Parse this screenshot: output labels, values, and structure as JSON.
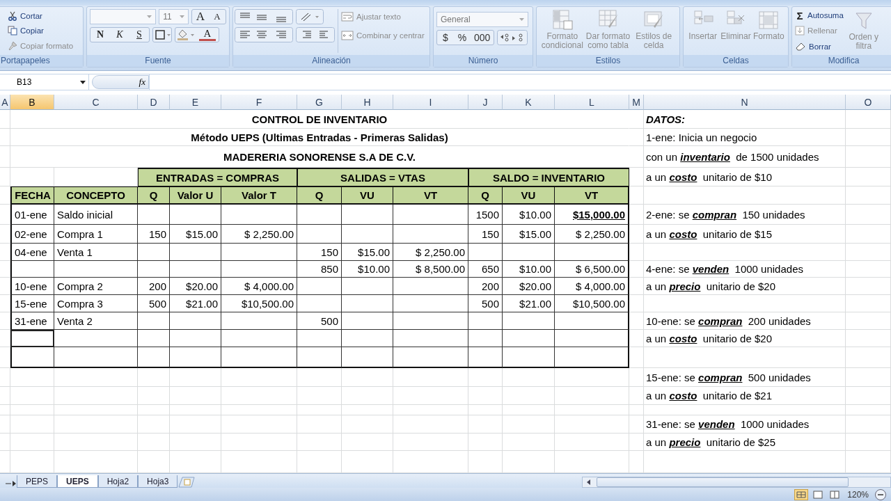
{
  "ribbon": {
    "clipboard": {
      "label": "Portapapeles",
      "items": [
        {
          "label": "Cortar",
          "kind": "cut",
          "disabled": false
        },
        {
          "label": "Copiar",
          "kind": "copy",
          "disabled": false
        },
        {
          "label": "Copiar formato",
          "kind": "brush",
          "disabled": true
        }
      ]
    },
    "font": {
      "label": "Fuente",
      "size": "11",
      "grow": "A",
      "shrink": "A",
      "styles": [
        "N",
        "K",
        "S"
      ],
      "color_button": "A"
    },
    "alignment": {
      "label": "Alineación",
      "items": [
        {
          "label": "Ajustar texto",
          "kind": "wrap",
          "disabled": true
        },
        {
          "label": "Combinar y centrar",
          "kind": "merge",
          "disabled": true
        }
      ]
    },
    "number": {
      "label": "Número",
      "format": "General",
      "buttons": [
        "$",
        "%",
        "000"
      ]
    },
    "styles": {
      "label": "Estilos",
      "items": [
        {
          "label": "Formato condicional",
          "kind": "conditional",
          "disabled": true
        },
        {
          "label": "Dar formato como tabla",
          "kind": "table",
          "disabled": true
        },
        {
          "label": "Estilos de celda",
          "kind": "cellstyle",
          "disabled": true
        }
      ]
    },
    "cells": {
      "label": "Celdas",
      "items": [
        {
          "label": "Insertar",
          "kind": "insert",
          "disabled": true
        },
        {
          "label": "Eliminar",
          "kind": "delete",
          "disabled": true
        },
        {
          "label": "Formato",
          "kind": "format",
          "disabled": true
        }
      ]
    },
    "editing": {
      "label": "Modifica",
      "items": [
        {
          "label": "Autosuma",
          "kind": "sum",
          "disabled": false
        },
        {
          "label": "Rellenar",
          "kind": "fill",
          "disabled": true
        },
        {
          "label": "Borrar",
          "kind": "erase",
          "disabled": false
        }
      ],
      "sum_symbol": "Σ",
      "sort_label": "Orden y filtra"
    }
  },
  "formula_bar": {
    "name_box": "B13",
    "function_label": "fx"
  },
  "columns": [
    {
      "label": "A",
      "selected": false
    },
    {
      "label": "B",
      "selected": true
    },
    {
      "label": "C",
      "selected": false
    },
    {
      "label": "D",
      "selected": false
    },
    {
      "label": "E",
      "selected": false
    },
    {
      "label": "F",
      "selected": false
    },
    {
      "label": "G",
      "selected": false
    },
    {
      "label": "H",
      "selected": false
    },
    {
      "label": "I",
      "selected": false
    },
    {
      "label": "J",
      "selected": false
    },
    {
      "label": "K",
      "selected": false
    },
    {
      "label": "L",
      "selected": false
    },
    {
      "label": "M",
      "selected": false
    },
    {
      "label": "N",
      "selected": false
    },
    {
      "label": "O",
      "selected": false
    }
  ],
  "rows": [
    {
      "kind": "title",
      "text": "CONTROL DE INVENTARIO",
      "note": {
        "text": "DATOS:",
        "heading": true
      }
    },
    {
      "kind": "title",
      "text": "Método UEPS (Ultimas Entradas - Primeras Salidas)",
      "note": {
        "text": "1-ene: Inicia un negocio",
        "heading": false
      }
    },
    {
      "kind": "title",
      "text": "MADERERIA SONORENSE S.A DE C.V.",
      "note": {
        "text": "con un **inventario**  de 1500 unidades",
        "heading": false
      }
    },
    {
      "kind": "group",
      "groups": [
        {
          "label": "ENTRADAS = COMPRAS"
        },
        {
          "label": "SALIDAS = VTAS"
        },
        {
          "label": "SALDO = INVENTARIO"
        }
      ],
      "note": {
        "text": "a un **costo**  unitario de $10",
        "heading": false
      }
    },
    {
      "kind": "header",
      "cells": [
        "FECHA",
        "CONCEPTO",
        "Q",
        "Valor U",
        "Valor T",
        "Q",
        "VU",
        "VT",
        "Q",
        "VU",
        "VT"
      ]
    },
    {
      "kind": "data",
      "selected": false,
      "saldo_vt_bold": true,
      "fecha": "01-ene",
      "concepto": "Saldo inicial",
      "saldo_q": "1500",
      "saldo_vu": "$10.00",
      "saldo_vt": "$15,000.00",
      "note": {
        "text": "2-ene: se **compran**  150 unidades",
        "heading": false
      }
    },
    {
      "kind": "data",
      "selected": false,
      "saldo_vt_bold": false,
      "fecha": "02-ene",
      "concepto": "Compra 1",
      "entrada_q": "150",
      "entrada_vu": "$15.00",
      "entrada_vt": "$ 2,250.00",
      "saldo_q": "150",
      "saldo_vu": "$15.00",
      "saldo_vt": "$ 2,250.00",
      "note": {
        "text": "a un **costo**  unitario de $15",
        "heading": false
      }
    },
    {
      "kind": "data",
      "selected": false,
      "fecha": "04-ene",
      "concepto": "Venta 1",
      "salida_q": "150",
      "salida_vu": "$15.00",
      "salida_vt": "$ 2,250.00"
    },
    {
      "kind": "data",
      "selected": false,
      "saldo_vt_bold": false,
      "salida_q": "850",
      "salida_vu": "$10.00",
      "salida_vt": "$ 8,500.00",
      "saldo_q": "650",
      "saldo_vu": "$10.00",
      "saldo_vt": "$ 6,500.00",
      "note": {
        "text": "4-ene: se **venden**  1000 unidades",
        "heading": false
      }
    },
    {
      "kind": "data",
      "selected": false,
      "saldo_vt_bold": false,
      "fecha": "10-ene",
      "concepto": "Compra 2",
      "entrada_q": "200",
      "entrada_vu": "$20.00",
      "entrada_vt": "$ 4,000.00",
      "saldo_q": "200",
      "saldo_vu": "$20.00",
      "saldo_vt": "$ 4,000.00",
      "note": {
        "text": "a un **precio**  unitario de $20",
        "heading": false
      }
    },
    {
      "kind": "data",
      "selected": false,
      "saldo_vt_bold": false,
      "fecha": "15-ene",
      "concepto": "Compra 3",
      "entrada_q": "500",
      "entrada_vu": "$21.00",
      "entrada_vt": "$10,500.00",
      "saldo_q": "500",
      "saldo_vu": "$21.00",
      "saldo_vt": "$10,500.00"
    },
    {
      "kind": "data",
      "selected": false,
      "fecha": "31-ene",
      "concepto": "Venta 2",
      "salida_q": "500",
      "note": {
        "text": "10-ene: se **compran**  200 unidades",
        "heading": false
      }
    },
    {
      "kind": "data",
      "selected": true,
      "note": {
        "text": "a un **costo**  unitario de $20",
        "heading": false
      }
    },
    {
      "kind": "data",
      "selected": false
    },
    {
      "kind": "blank",
      "note": {
        "text": "15-ene: se **compran**  500 unidades",
        "heading": false
      }
    },
    {
      "kind": "blank",
      "note": {
        "text": "a un **costo**  unitario de $21",
        "heading": false
      }
    },
    {
      "kind": "blank"
    },
    {
      "kind": "blank",
      "note": {
        "text": "31-ene: se **venden**  1000 unidades",
        "heading": false
      }
    },
    {
      "kind": "blank",
      "note": {
        "text": "a un **precio**  unitario de $25",
        "heading": false
      }
    },
    {
      "kind": "blank"
    }
  ],
  "sheet_tabs": [
    {
      "label": "PEPS",
      "selected": false
    },
    {
      "label": "UEPS",
      "selected": true
    },
    {
      "label": "Hoja2",
      "selected": false
    },
    {
      "label": "Hoja3",
      "selected": false
    }
  ],
  "status_bar": {
    "zoom": "120%"
  }
}
